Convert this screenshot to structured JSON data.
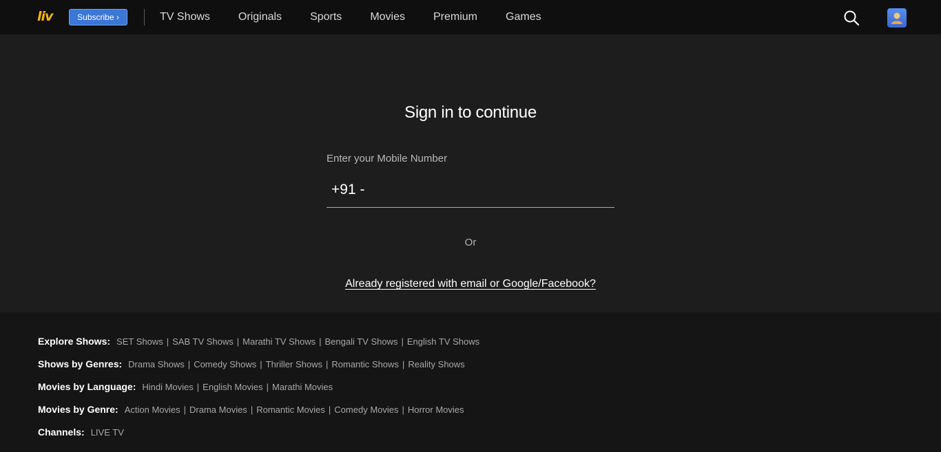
{
  "header": {
    "logo_text": "liv",
    "subscribe_label": "Subscribe ›",
    "nav": [
      "TV Shows",
      "Originals",
      "Sports",
      "Movies",
      "Premium",
      "Games"
    ],
    "icons": {
      "search": "search-icon",
      "profile": "avatar"
    }
  },
  "signin": {
    "title": "Sign in to continue",
    "mobile_label": "Enter your Mobile Number",
    "country_code": "+91 -",
    "phone_value": "",
    "or_text": "Or",
    "email_link": "Already registered with email or Google/Facebook?"
  },
  "footer": {
    "rows": [
      {
        "heading": "Explore Shows:",
        "links": [
          "SET Shows",
          "SAB TV Shows",
          "Marathi TV Shows",
          "Bengali TV Shows",
          "English TV Shows"
        ]
      },
      {
        "heading": "Shows by Genres:",
        "links": [
          "Drama Shows",
          "Comedy Shows",
          "Thriller Shows",
          "Romantic Shows",
          "Reality Shows"
        ]
      },
      {
        "heading": "Movies by Language:",
        "links": [
          "Hindi Movies",
          "English Movies",
          "Marathi Movies"
        ]
      },
      {
        "heading": "Movies by Genre:",
        "links": [
          "Action Movies",
          "Drama Movies",
          "Romantic Movies",
          "Comedy Movies",
          "Horror Movies"
        ]
      },
      {
        "heading": "Channels:",
        "links": [
          "LIVE TV"
        ]
      }
    ]
  },
  "colors": {
    "header_bg": "#0f0f0f",
    "page_bg": "#1e1d1d",
    "footer_bg": "#151515",
    "logo": "#f5b50a",
    "subscribe_bg": "#3a77d6"
  }
}
